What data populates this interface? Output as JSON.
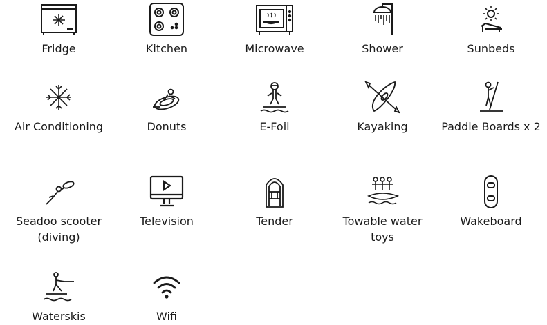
{
  "amenities": [
    {
      "label": "Fridge",
      "icon": "fridge-icon"
    },
    {
      "label": "Kitchen",
      "icon": "cooktop-icon"
    },
    {
      "label": "Microwave",
      "icon": "microwave-icon"
    },
    {
      "label": "Shower",
      "icon": "shower-icon"
    },
    {
      "label": "Sunbeds",
      "icon": "sunbed-icon"
    },
    {
      "label": "Air Conditioning",
      "icon": "snowflake-icon"
    },
    {
      "label": "Donuts",
      "icon": "towable-donut-icon"
    },
    {
      "label": "E-Foil",
      "icon": "efoil-rider-icon"
    },
    {
      "label": "Kayaking",
      "icon": "kayak-icon"
    },
    {
      "label": "Paddle Boards x 2",
      "icon": "paddle-board-icon"
    },
    {
      "label": "Seadoo scooter (diving)",
      "icon": "diver-scooter-icon"
    },
    {
      "label": "Television",
      "icon": "television-icon"
    },
    {
      "label": "Tender",
      "icon": "tender-boat-icon"
    },
    {
      "label": "Towable water toys",
      "icon": "towable-riders-icon"
    },
    {
      "label": "Wakeboard",
      "icon": "wakeboard-icon"
    },
    {
      "label": "Waterskis",
      "icon": "waterskier-icon"
    },
    {
      "label": "Wifi",
      "icon": "wifi-icon"
    }
  ]
}
